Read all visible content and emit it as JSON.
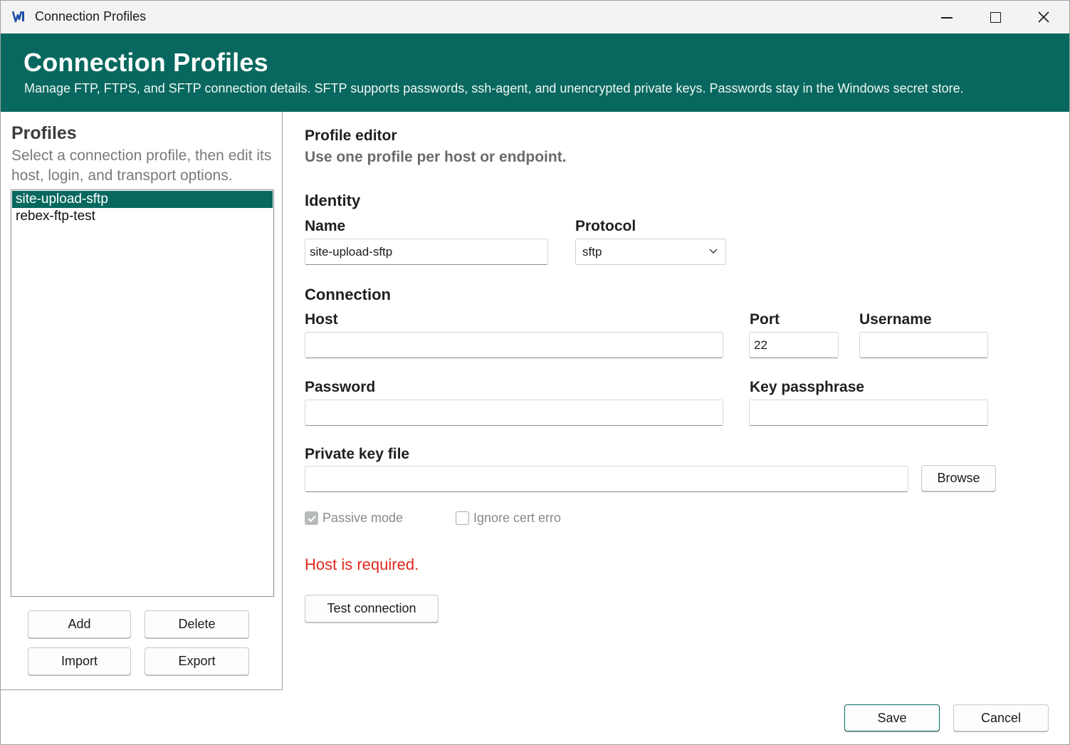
{
  "window": {
    "title": "Connection Profiles"
  },
  "banner": {
    "title": "Connection Profiles",
    "subtitle": "Manage FTP, FTPS, and SFTP connection details. SFTP supports passwords, ssh-agent, and unencrypted private keys. Passwords stay in the Windows secret store."
  },
  "sidebar": {
    "title": "Profiles",
    "description": "Select a connection profile, then edit its host, login, and transport options.",
    "profiles": [
      {
        "label": "site-upload-sftp",
        "selected": true
      },
      {
        "label": "rebex-ftp-test",
        "selected": false
      }
    ],
    "buttons": {
      "add": "Add",
      "delete": "Delete",
      "import": "Import",
      "export": "Export"
    }
  },
  "editor": {
    "title": "Profile editor",
    "subtitle": "Use one profile per host or endpoint.",
    "identity": {
      "section": "Identity",
      "name_label": "Name",
      "name_value": "site-upload-sftp",
      "protocol_label": "Protocol",
      "protocol_value": "sftp"
    },
    "connection": {
      "section": "Connection",
      "host_label": "Host",
      "host_value": "",
      "port_label": "Port",
      "port_value": "22",
      "username_label": "Username",
      "username_value": "",
      "password_label": "Password",
      "password_value": "",
      "key_passphrase_label": "Key passphrase",
      "key_passphrase_value": "",
      "private_key_label": "Private key file",
      "private_key_value": "",
      "browse_label": "Browse"
    },
    "options": {
      "passive_mode_label": "Passive mode",
      "passive_mode_checked": true,
      "ignore_cert_label": "Ignore cert erro",
      "ignore_cert_checked": false
    },
    "error": "Host is required.",
    "test_connection_label": "Test connection"
  },
  "footer": {
    "save_label": "Save",
    "cancel_label": "Cancel"
  },
  "colors": {
    "accent": "#08685f",
    "error": "#e0281e"
  }
}
